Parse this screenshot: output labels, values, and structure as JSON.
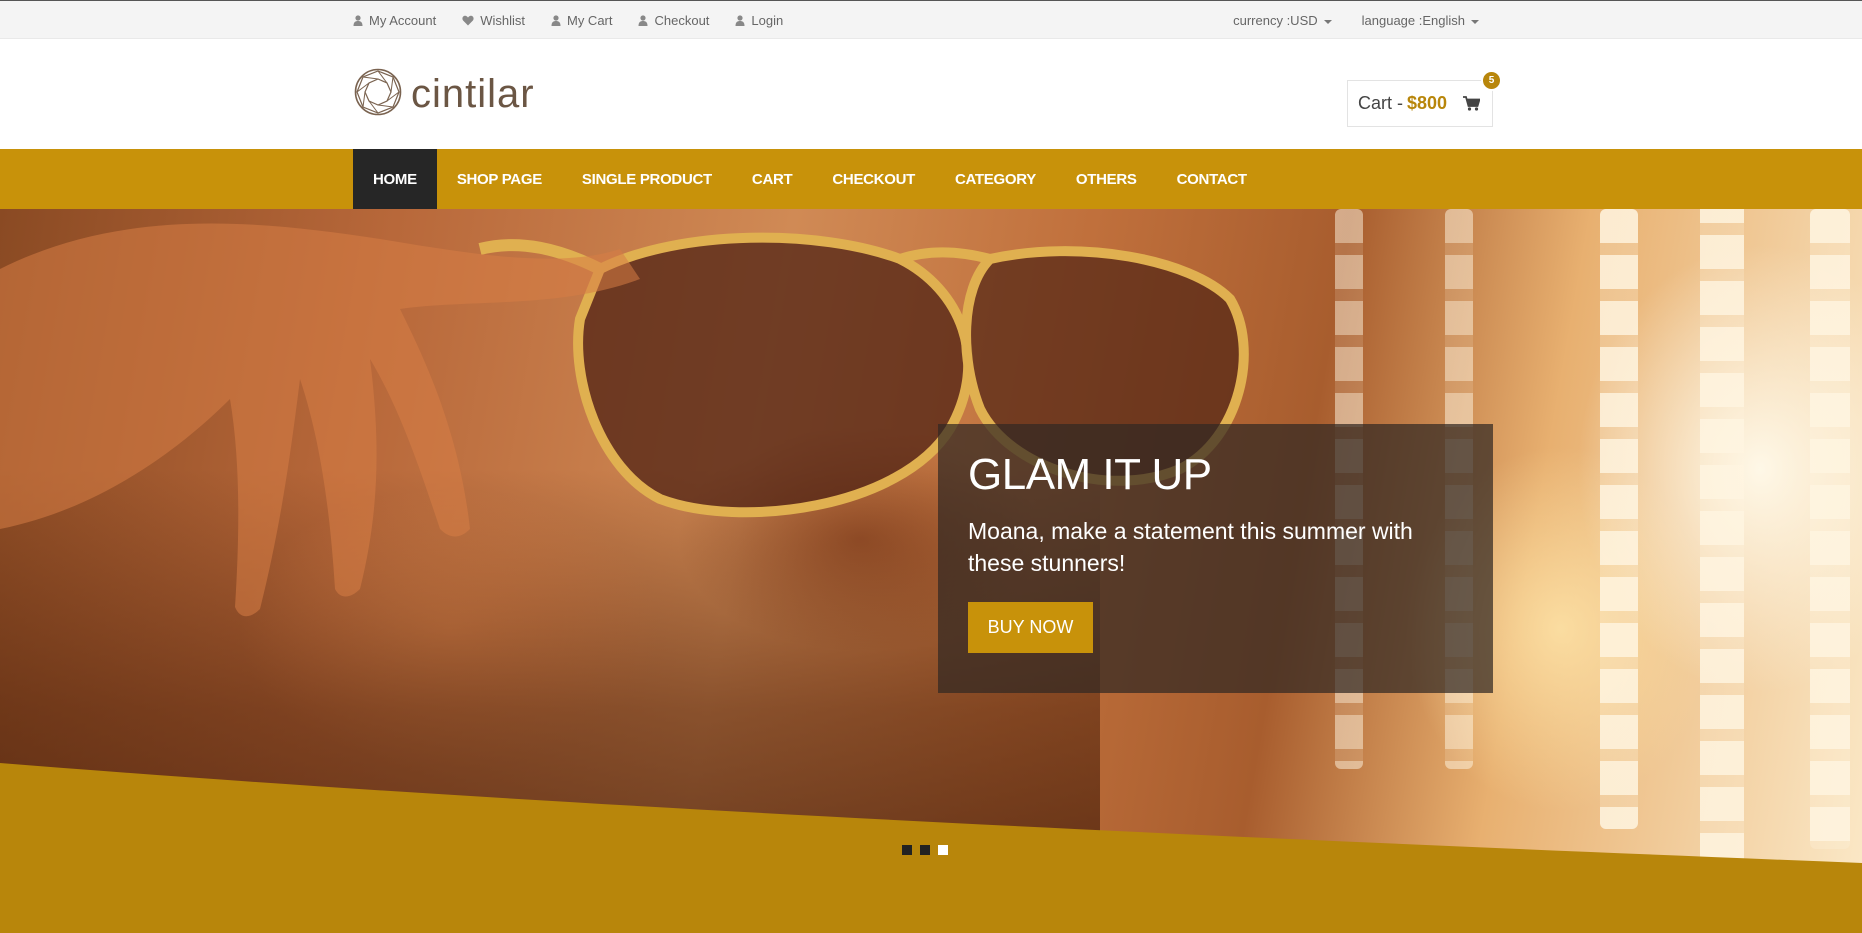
{
  "topbar": {
    "links": [
      {
        "label": "My Account",
        "icon": "user-icon"
      },
      {
        "label": "Wishlist",
        "icon": "heart-icon"
      },
      {
        "label": "My Cart",
        "icon": "user-icon"
      },
      {
        "label": "Checkout",
        "icon": "user-icon"
      },
      {
        "label": "Login",
        "icon": "user-icon"
      }
    ],
    "currency": "currency :USD",
    "language": "language :English"
  },
  "header": {
    "logo": "cintilar",
    "cart_label": "Cart -",
    "cart_amount": "$800",
    "cart_count": "5"
  },
  "nav": {
    "items": [
      "HOME",
      "SHOP PAGE",
      "SINGLE PRODUCT",
      "CART",
      "CHECKOUT",
      "CATEGORY",
      "OTHERS",
      "CONTACT"
    ],
    "active": "HOME"
  },
  "hero": {
    "title": "GLAM IT UP",
    "text": "Moana, make a statement this summer with these stunners!",
    "button": "BUY NOW",
    "slides": 3,
    "active_slide": 3
  },
  "colors": {
    "accent": "#c8920a",
    "dark": "#262626",
    "wave": "#b8860b"
  }
}
